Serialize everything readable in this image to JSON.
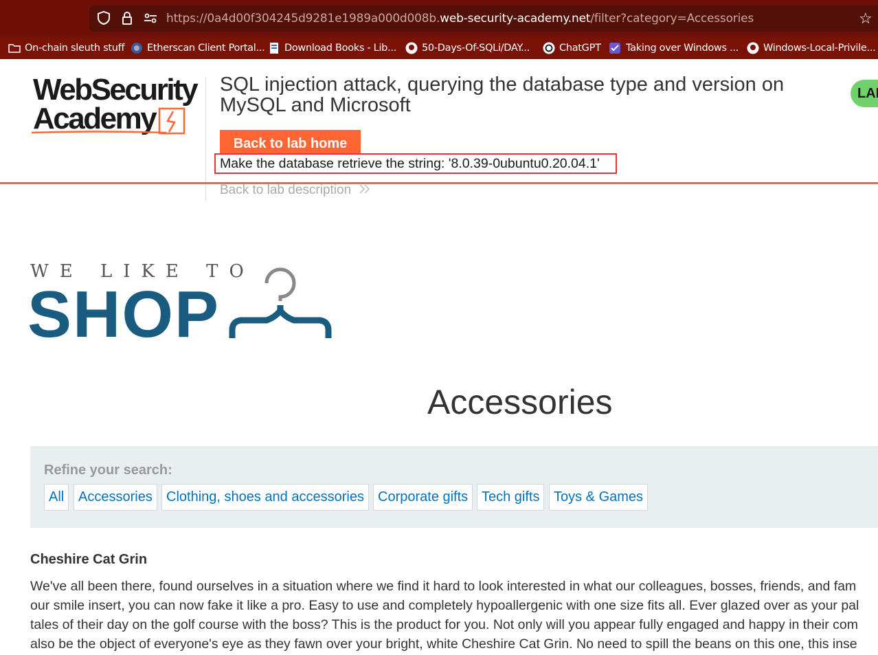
{
  "browser": {
    "url_prefix": "https://0a4d00f304245d9281e1989a000d008b.",
    "url_domain": "web-security-academy.net",
    "url_path": "/filter?category=Accessories",
    "bookmarks": [
      {
        "label": "On-chain sleuth stuff",
        "icon": "folder-icon"
      },
      {
        "label": "Etherscan Client Portal...",
        "icon": "etherscan-icon"
      },
      {
        "label": "Download Books - Lib...",
        "icon": "book-icon"
      },
      {
        "label": "50-Days-Of-SQLi/DAY...",
        "icon": "github-icon"
      },
      {
        "label": "ChatGPT",
        "icon": "chatgpt-icon"
      },
      {
        "label": "Taking over Windows ...",
        "icon": "checklist-icon"
      },
      {
        "label": "Windows-Local-Privile...",
        "icon": "github-icon"
      }
    ]
  },
  "lab": {
    "logo_line1": "WebSecurity",
    "logo_line2": "Academy",
    "title": "SQL injection attack, querying the database type and version on MySQL and Microsoft",
    "badge": "LAB",
    "back_home": "Back to lab home",
    "objective": "Make the database retrieve the string: '8.0.39-0ubuntu0.20.04.1'",
    "back_description": "Back to lab description"
  },
  "shop": {
    "tagline": "WE LIKE TO",
    "name": "SHOP"
  },
  "page": {
    "title": "Accessories",
    "refine_label": "Refine your search:",
    "filters": [
      "All",
      "Accessories",
      "Clothing, shoes and accessories",
      "Corporate gifts",
      "Tech gifts",
      "Toys & Games"
    ]
  },
  "product": {
    "name": "Cheshire Cat Grin",
    "desc_lines": [
      "We've all been there, found ourselves in a situation where we find it hard to look interested in what our colleagues, bosses, friends, and fam",
      "our smile insert, you can now fake it like a pro. Easy to use and completely hypoallergenic with one size fits all. Ever glazed over as your pal",
      "tales of their day on the golf course with the boss? This is the product for you. Not only will you appear fully engaged and happy in their com",
      "also be the object of everyone's eye as they fawn over your bright, white Cheshire Cat Grin. No need to spill the beans on this one, this inse"
    ]
  },
  "colors": {
    "accent": "#ff6633",
    "shop_blue": "#1a5c80",
    "link": "#0071bc",
    "lab_badge": "#70d16d"
  }
}
